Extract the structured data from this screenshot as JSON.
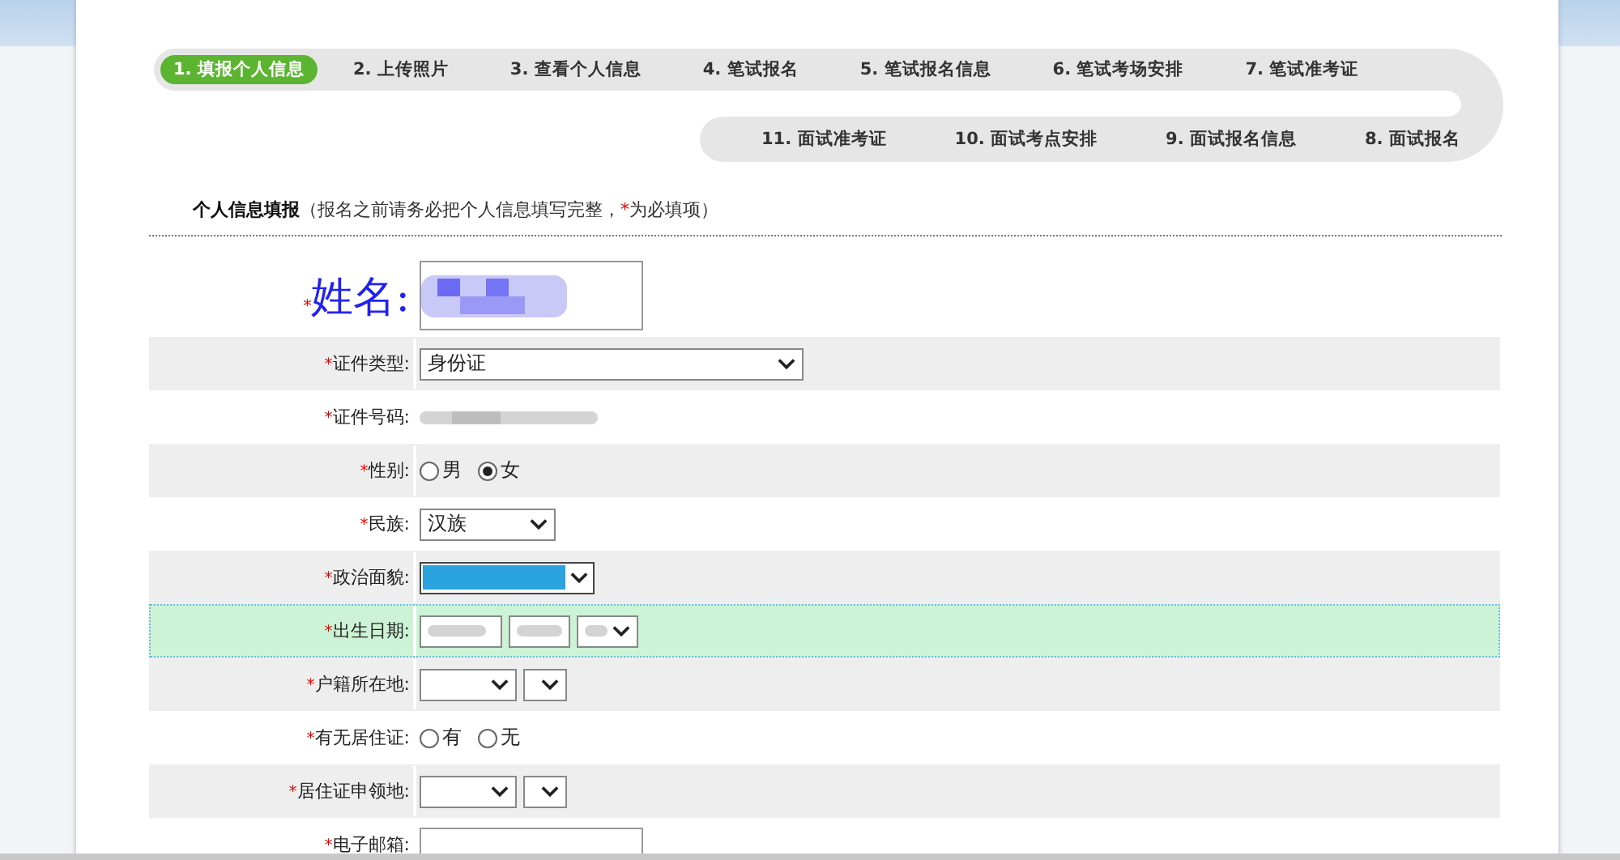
{
  "steps_row_1": [
    {
      "label": "1. 填报个人信息",
      "selected": true
    },
    {
      "label": "2. 上传照片",
      "selected": false
    },
    {
      "label": "3. 查看个人信息",
      "selected": false
    },
    {
      "label": "4. 笔试报名",
      "selected": false
    },
    {
      "label": "5. 笔试报名信息",
      "selected": false
    },
    {
      "label": "6. 笔试考场安排",
      "selected": false
    },
    {
      "label": "7. 笔试准考证",
      "selected": false
    }
  ],
  "steps_row_2": [
    {
      "label": "11. 面试准考证",
      "selected": false
    },
    {
      "label": "10. 面试考点安排",
      "selected": false
    },
    {
      "label": "9. 面试报名信息",
      "selected": false
    },
    {
      "label": "8. 面试报名",
      "selected": false
    }
  ],
  "section": {
    "title": "个人信息填报",
    "note": [
      {
        "text": "（报名之前请务必把个人信息填写完整，",
        "kind": "plain"
      },
      {
        "text": "*",
        "kind": "mark"
      },
      {
        "text": "为必填项）",
        "kind": "plain"
      }
    ]
  },
  "form_rows": [
    {
      "kind": "name",
      "required_mark": "*",
      "label": "姓名:",
      "shaded": false,
      "highlighted": false
    },
    {
      "kind": "select",
      "required_mark": "*",
      "label": "证件类型:",
      "value": "身份证",
      "shaded": true,
      "highlighted": false
    },
    {
      "kind": "redacted",
      "required_mark": "*",
      "label": "证件号码:",
      "shaded": false,
      "highlighted": false
    },
    {
      "kind": "radio",
      "required_mark": "*",
      "label": "性别:",
      "options": [
        {
          "label": "男",
          "selected": false
        },
        {
          "label": "女",
          "selected": true
        }
      ],
      "shaded": true,
      "highlighted": false
    },
    {
      "kind": "small-select",
      "required_mark": "*",
      "label": "民族:",
      "value": "汉族",
      "shaded": false,
      "highlighted": false
    },
    {
      "kind": "redacted-select",
      "required_mark": "*",
      "label": "政治面貌:",
      "shaded": true,
      "highlighted": false
    },
    {
      "kind": "date",
      "required_mark": "*",
      "label": "出生日期:",
      "shaded": false,
      "highlighted": true
    },
    {
      "kind": "region",
      "required_mark": "*",
      "label": "户籍所在地:",
      "shaded": true,
      "highlighted": false
    },
    {
      "kind": "radio",
      "required_mark": "*",
      "label": "有无居住证:",
      "options": [
        {
          "label": "有",
          "selected": false
        },
        {
          "label": "无",
          "selected": false
        }
      ],
      "shaded": false,
      "highlighted": false
    },
    {
      "kind": "region",
      "required_mark": "*",
      "label": "居住证申领地:",
      "shaded": true,
      "highlighted": false
    },
    {
      "kind": "input",
      "required_mark": "*",
      "label": "电子邮箱:",
      "shaded": false,
      "highlighted": false
    }
  ]
}
